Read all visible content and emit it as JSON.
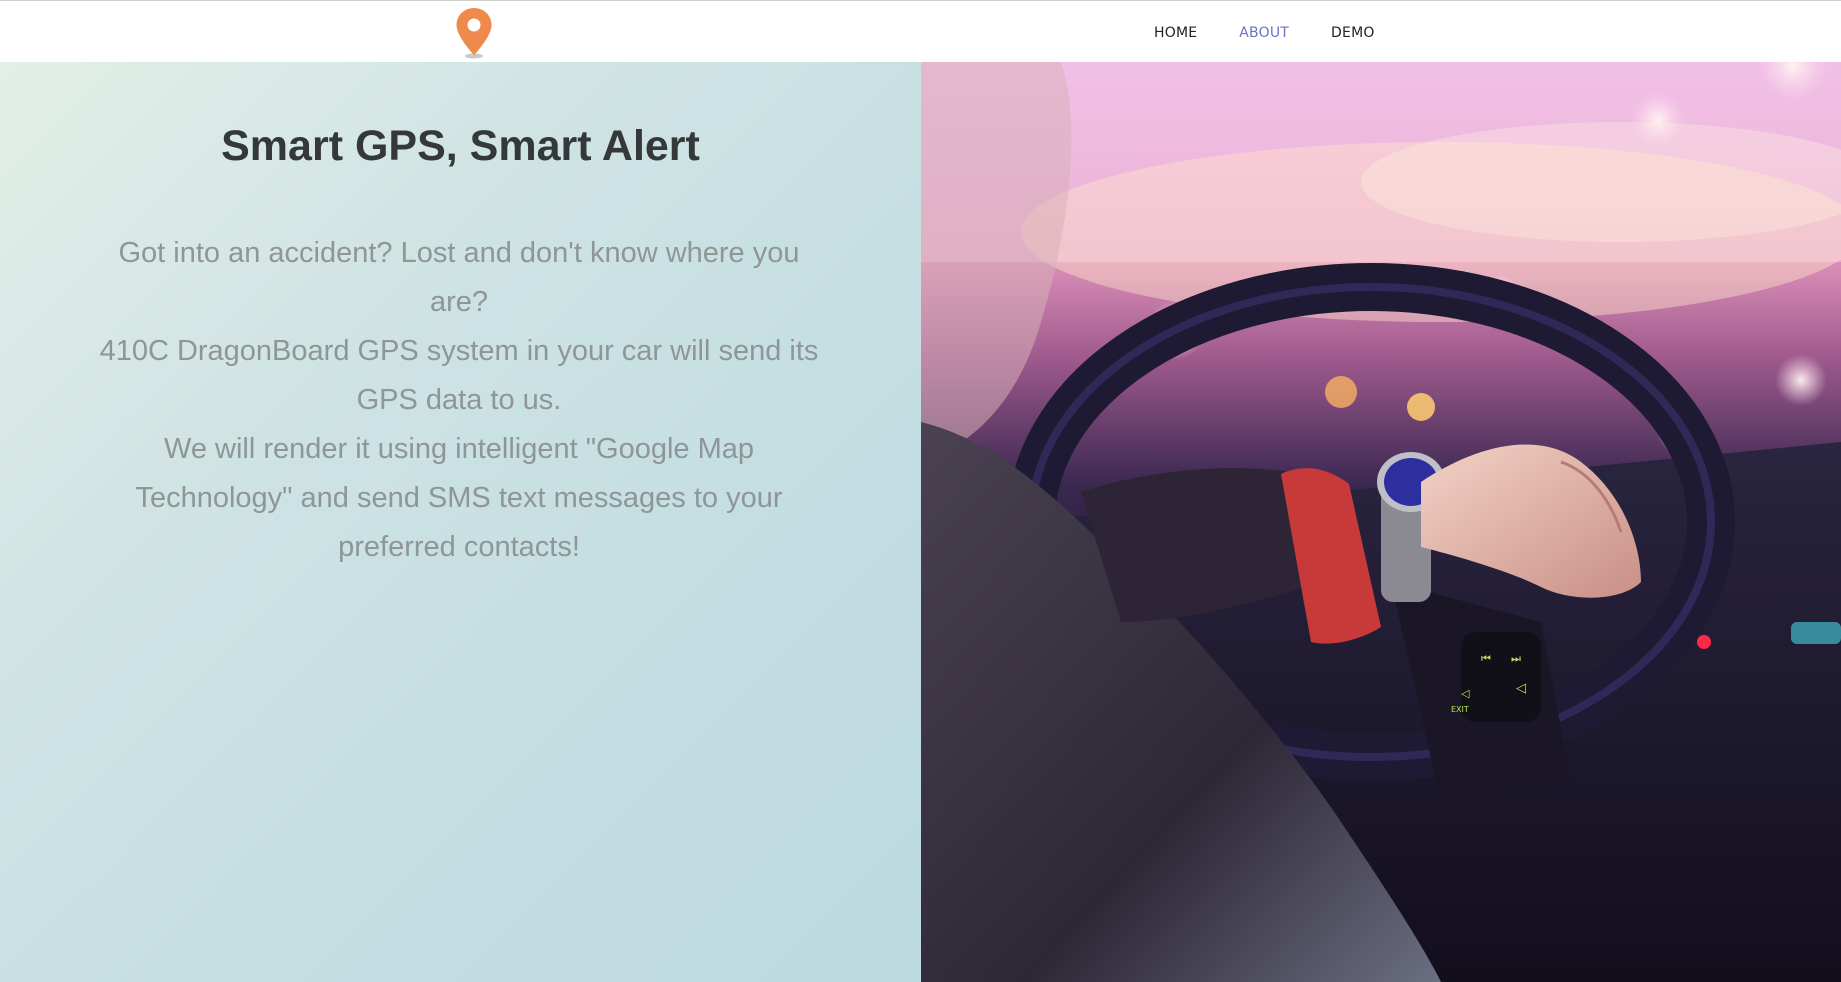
{
  "nav": {
    "logo_icon": "map-pin-icon",
    "links": [
      {
        "label": "HOME",
        "active": false
      },
      {
        "label": "ABOUT",
        "active": true
      },
      {
        "label": "DEMO",
        "active": false
      }
    ]
  },
  "hero": {
    "title": "Smart GPS, Smart Alert",
    "lines": [
      "Got into an accident? Lost and don't know where you are?",
      "410C DragonBoard GPS system in your car will send its GPS data to us.",
      "We will render it using intelligent \"Google Map Technology\" and send SMS text messages to your preferred contacts!"
    ]
  },
  "colors": {
    "accent_orange": "#ef8a4d",
    "active_link": "#6b72c6",
    "title_text": "#343838",
    "body_text": "#8e9696"
  }
}
